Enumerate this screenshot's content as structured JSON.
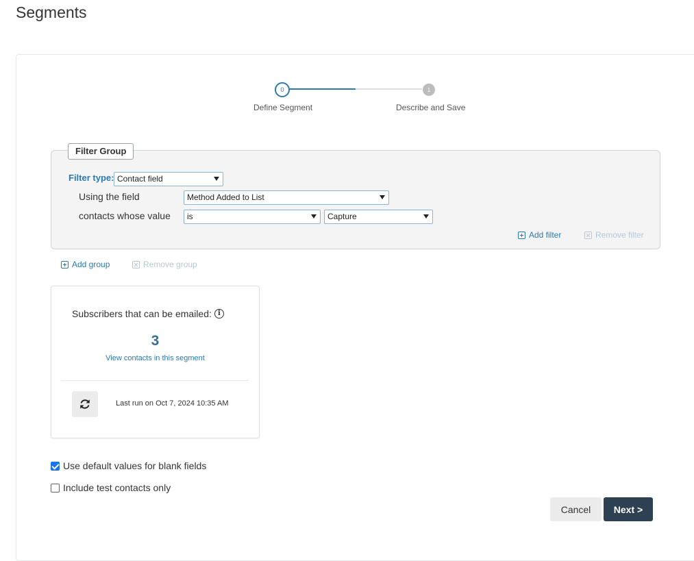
{
  "page": {
    "title": "Segments"
  },
  "stepper": {
    "steps": [
      {
        "number": "0",
        "label": "Define Segment",
        "state": "active"
      },
      {
        "number": "1",
        "label": "Describe and Save",
        "state": "inactive"
      }
    ],
    "active_color": "#2a7ab0"
  },
  "filter_group": {
    "legend": "Filter Group",
    "filter_type_label": "Filter type:",
    "filter_type_value": "Contact field",
    "using_field_label": "Using the field",
    "using_field_value": "Method Added to List",
    "contacts_value_label": "contacts whose value",
    "operator_value": "is",
    "value_value": "Capture",
    "add_filter": "Add filter",
    "remove_filter": "Remove filter"
  },
  "group_actions": {
    "add_group": "Add group",
    "remove_group": "Remove group"
  },
  "subscribers": {
    "label": "Subscribers that can be emailed:",
    "count": "3",
    "view_link": "View contacts in this segment",
    "last_run": "Last run on Oct 7, 2024 10:35 AM"
  },
  "options": {
    "use_default": {
      "label": "Use default values for blank fields",
      "checked": true
    },
    "test_only": {
      "label": "Include test contacts only",
      "checked": false
    }
  },
  "buttons": {
    "cancel": "Cancel",
    "next": "Next >"
  },
  "colors": {
    "primary_button": "#2e4152",
    "link": "#2a7ab0",
    "count": "#3a6f94"
  }
}
